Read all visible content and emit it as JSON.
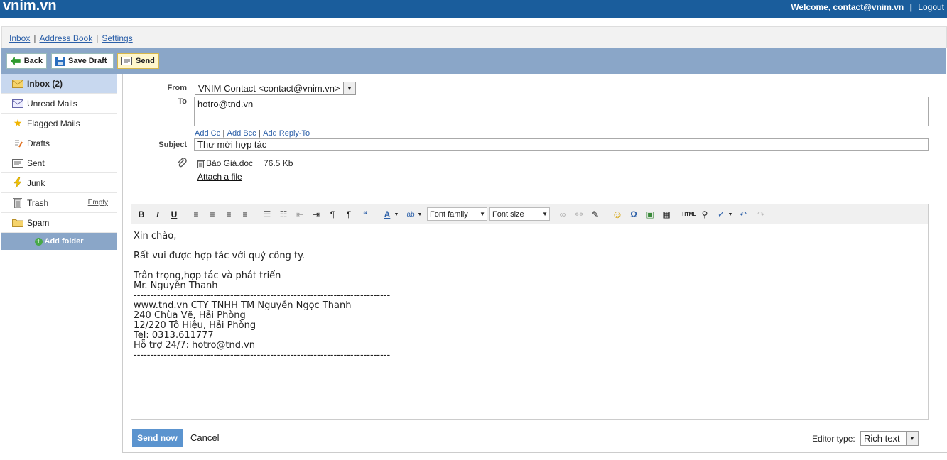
{
  "header": {
    "logo": "vnim.vn",
    "welcome": "Welcome, contact@vnim.vn",
    "logout": "Logout"
  },
  "nav": {
    "inbox": "Inbox",
    "address_book": "Address Book",
    "settings": "Settings"
  },
  "toolbar": {
    "back": "Back",
    "save_draft": "Save Draft",
    "send": "Send"
  },
  "sidebar": {
    "folders": [
      {
        "label": "Inbox",
        "count": "(2)",
        "icon": "envelope-icon"
      },
      {
        "label": "Unread Mails",
        "icon": "unread-envelope-icon"
      },
      {
        "label": "Flagged Mails",
        "icon": "star-icon"
      },
      {
        "label": "Drafts",
        "icon": "draft-icon"
      },
      {
        "label": "Sent",
        "icon": "sent-icon"
      },
      {
        "label": "Junk",
        "icon": "lightning-icon"
      },
      {
        "label": "Trash",
        "icon": "trash-icon",
        "extra": "Empty"
      },
      {
        "label": "Spam",
        "icon": "folder-icon"
      }
    ],
    "add_folder": "Add folder"
  },
  "compose": {
    "from_label": "From",
    "from_value": "VNIM Contact <contact@vnim.vn>",
    "to_label": "To",
    "to_value": "hotro@tnd.vn",
    "add_cc": "Add Cc",
    "add_bcc": "Add Bcc",
    "add_reply_to": "Add Reply-To",
    "subject_label": "Subject",
    "subject_value": "Thư mời hợp tác",
    "attachment_name": "Báo Giá.doc",
    "attachment_size": "76.5 Kb",
    "attach_link": "Attach a file"
  },
  "editor": {
    "font_family": "Font family",
    "font_size": "Font size",
    "body_lines": [
      "Xin chào,",
      "",
      "Rất vui được hợp tác với quý công ty.",
      "",
      "Trân trọng,hợp tác và phát triển",
      "Mr. Nguyễn Thanh",
      "-----------------------------------------------------------------------------",
      "www.tnd.vn CTY TNHH TM Nguyễn Ngọc Thanh",
      "240 Chùa Vẽ, Hải Phòng",
      "12/220 Tô Hiệu, Hải Phòng",
      "Tel: 0313.611777",
      "Hỗ trợ 24/7: hotro@tnd.vn",
      "-----------------------------------------------------------------------------"
    ]
  },
  "footer": {
    "send_now": "Send now",
    "cancel": "Cancel",
    "editor_type_label": "Editor type:",
    "editor_type_value": "Rich text"
  }
}
